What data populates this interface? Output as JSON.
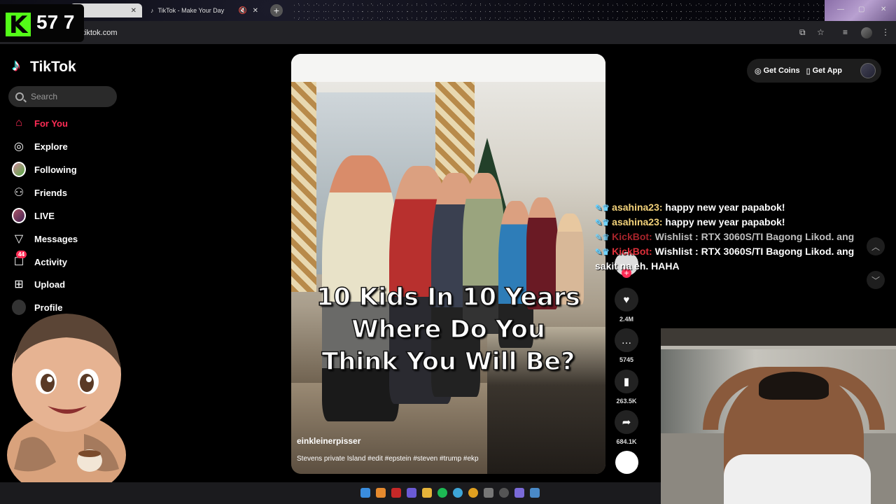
{
  "browser": {
    "tabs": [
      {
        "label": ""
      },
      {
        "label": "TikTok - Make Your Day"
      }
    ],
    "url": "tiktok.com",
    "new_tab": "+"
  },
  "stream_overlay": {
    "viewer_count": "57 7",
    "brand_color": "#53fc18"
  },
  "sidebar": {
    "logo": "TikTok",
    "search_placeholder": "Search",
    "items": [
      {
        "label": "For You",
        "icon": "home-icon"
      },
      {
        "label": "Explore",
        "icon": "compass-icon"
      },
      {
        "label": "Following",
        "icon": "avatar"
      },
      {
        "label": "Friends",
        "icon": "friends-icon"
      },
      {
        "label": "LIVE",
        "icon": "avatar"
      },
      {
        "label": "Messages",
        "icon": "send-icon"
      },
      {
        "label": "Activity",
        "icon": "inbox-icon",
        "badge": "44"
      },
      {
        "label": "Upload",
        "icon": "plus-square-icon"
      },
      {
        "label": "Profile",
        "icon": "avatar"
      }
    ],
    "accent": "#fe2c55"
  },
  "video": {
    "caption_lines": [
      "10 Kids In 10 Years",
      "Where Do You",
      "Think You Will Be?"
    ],
    "author": "einkleinerpisser",
    "description": "Stevens private Island #edit #epstein #steven #trump #ekp",
    "actions": [
      {
        "icon": "heart-icon",
        "count": "2.4M"
      },
      {
        "icon": "comment-icon",
        "count": "5745"
      },
      {
        "icon": "bookmark-icon",
        "count": "263.5K"
      },
      {
        "icon": "share-icon",
        "count": "684.1K"
      }
    ]
  },
  "header_buttons": {
    "get_coins": "Get Coins",
    "get_app": "Get App"
  },
  "chat": [
    {
      "user": "asahina23:",
      "message": "happy new year papabok!"
    },
    {
      "user": "asahina23:",
      "message": "happy new year papabok!"
    },
    {
      "user": "KickBot:",
      "message": "Wishlist : RTX 3060S/TI Bagong Likod. ang"
    },
    {
      "user": "KickBot:",
      "message": "Wishlist : RTX 3060S/TI Bagong Likod. ang"
    },
    {
      "user": "",
      "message": "sakit na eh. HAHA"
    }
  ]
}
